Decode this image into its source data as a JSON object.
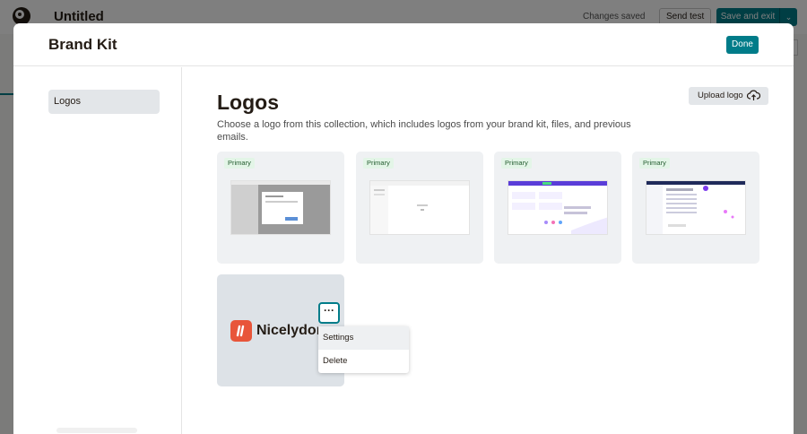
{
  "app": {
    "title": "Untitled",
    "status": "Changes saved",
    "send_test_label": "Send test",
    "save_exit_label": "Save and exit",
    "caret": "⌄"
  },
  "modal": {
    "title": "Brand Kit",
    "done_label": "Done"
  },
  "sidebar": {
    "items": [
      {
        "label": "Logos",
        "active": true
      }
    ]
  },
  "logos": {
    "title": "Logos",
    "description": "Choose a logo from this collection, which includes logos from your brand kit, files, and previous emails.",
    "upload_label": "Upload logo",
    "upload_icon": "cloud-upload-icon",
    "cards": [
      {
        "badge": "Primary",
        "thumb": "screenshot-dialog"
      },
      {
        "badge": "Primary",
        "thumb": "screenshot-blank-page"
      },
      {
        "badge": "Primary",
        "thumb": "screenshot-purple-banner"
      },
      {
        "badge": "Primary",
        "thumb": "screenshot-dashboard"
      }
    ],
    "brand_card": {
      "text": "Nicelydone",
      "more_icon": "ellipsis-icon",
      "more_label": "···",
      "menu": [
        {
          "label": "Settings",
          "active": true
        },
        {
          "label": "Delete",
          "active": false
        }
      ]
    }
  },
  "colors": {
    "accent": "#007c89",
    "brand_orange": "#e8553a",
    "badge_bg": "#e3f5e7"
  }
}
